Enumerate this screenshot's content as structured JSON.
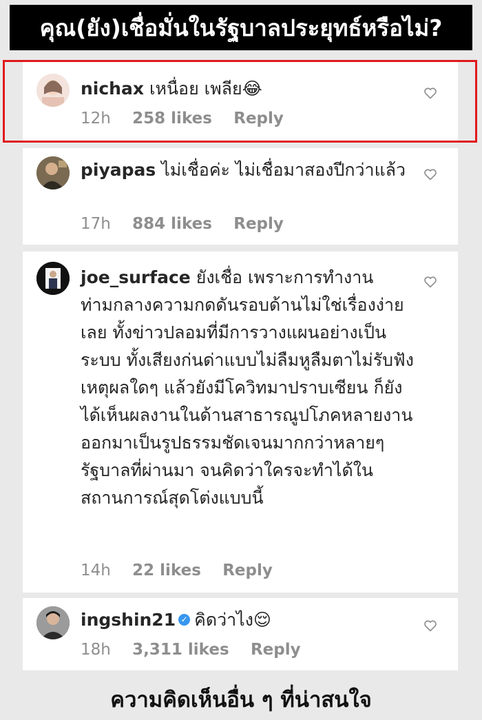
{
  "header": {
    "title": "คุณ(ยัง)เชื่อมั่นในรัฐบาลประยุทธ์หรือไม่?"
  },
  "comments": [
    {
      "username": "nichax",
      "text": "เหนื่อย เพลีย😂",
      "time": "12h",
      "likes": "258 likes",
      "reply": "Reply"
    },
    {
      "username": "piyapas",
      "text": "ไม่เชื่อค่ะ ไม่เชื่อมาสองปีกว่าแล้ว",
      "time": "17h",
      "likes": "884 likes",
      "reply": "Reply"
    },
    {
      "username": "joe_surface",
      "text": "ยังเชื่อ เพราะการทำงานท่ามกลางความกดดันรอบด้านไม่ใช่เรื่องง่ายเลย ทั้งข่าวปลอมที่มีการวางแผนอย่างเป็นระบบ ทั้งเสียงก่นด่าแบบไม่ลืมหูลืมตาไม่รับฟังเหตุผลใดๆ แล้วยังมีโควิทมาปราบเซียน ก็ยังได้เห็นผลงานในด้านสาธารณูปโภคหลายงานออกมาเป็นรูปธรรมชัดเจนมากกว่าหลายๆรัฐบาลที่ผ่านมา จนคิดว่าใครจะทำได้ในสถานการณ์สุดโต่งแบบนี้",
      "time": "14h",
      "likes": "22 likes",
      "reply": "Reply"
    },
    {
      "username": "ingshin21",
      "text": "คิดว่าไง😌",
      "time": "18h",
      "likes": "3,311 likes",
      "reply": "Reply"
    }
  ],
  "footer": {
    "caption": "ความคิดเห็นอื่น ๆ ที่น่าสนใจ"
  },
  "colors": {
    "highlight": "#e0191e",
    "verified": "#3897f0",
    "meta": "#8e8e8e"
  },
  "icons": [
    "heart-icon",
    "verified-badge-icon"
  ]
}
